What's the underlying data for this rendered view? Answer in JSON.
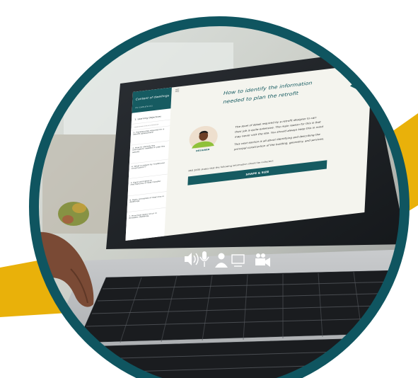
{
  "colors": {
    "ring": "#0f5560",
    "accent_yellow": "#e9b10a",
    "sidebar": "#ffffff",
    "sidebar_header": "#165b61",
    "page_bg": "#f4f4ee",
    "button": "#165b61",
    "avatar_bg": "#eedfce",
    "avatar_shirt": "#8fc13a"
  },
  "course": {
    "sidebar": {
      "title": "Content of dwellings",
      "progress_label": "0% COMPLETE 0/11",
      "items": [
        "1. Learning Objectives",
        "DEMARCATION OF SKILLS IN EVALUATION",
        "2. Prerequisites required for a retrofit assessment",
        "3. How to identify the information needed to plan the retrofit",
        "4. What is meant by 'traditional construction'?",
        "5. Basic principles & mechanisms of heat transfer",
        "6. Basic principles of heat loss in dwellings",
        "7. How heat gains occur in domestic dwellings"
      ]
    },
    "lesson": {
      "title_line1": "How to identify the information",
      "title_line2": "needed to plan the retrofit",
      "avatar_label": "DESIGNER",
      "para1_line1": "The level of detail required by a retrofit designer to carr",
      "para1_line2": "their job is quite extensive. The main reason for this is that",
      "para1_line3": "may never visit the site. You should always keep this in mind",
      "para2_line1": "This next section is all about identifying and describing the",
      "para2_line2": "principal construction of the building, geometry, and services.",
      "pas_note": "PAS 2035 states that the following information should be collected:",
      "button_label": "SHAPE & SIZE"
    },
    "menu_icon": "hamburger-icon"
  },
  "taskbar_icons": [
    "speaker-icon",
    "microphone-icon",
    "user-icon",
    "monitor-icon",
    "video-camera-icon"
  ]
}
